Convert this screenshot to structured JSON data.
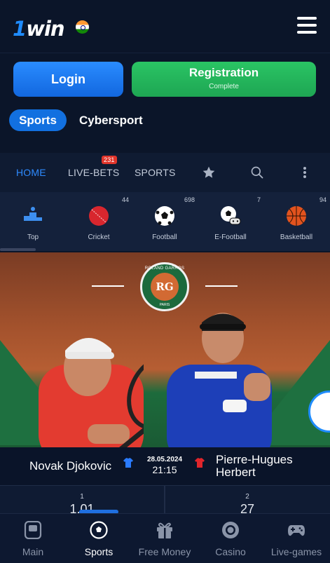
{
  "header": {
    "logo_one": "1",
    "logo_win": "win",
    "menu_icon": "hamburger-menu-icon"
  },
  "auth": {
    "login_label": "Login",
    "registration_label": "Registration",
    "registration_sub": "Complete"
  },
  "mode_toggle": {
    "sports": "Sports",
    "cybersport": "Cybersport"
  },
  "nav": {
    "home": "HOME",
    "live_bets": "LIVE-BETS",
    "live_bets_badge": "231",
    "sports": "SPORTS",
    "favorites_icon": "star-icon",
    "search_icon": "search-icon",
    "more_icon": "more-vertical-icon"
  },
  "categories": [
    {
      "label": "Top",
      "count": "",
      "icon": "podium-icon"
    },
    {
      "label": "Cricket",
      "count": "44",
      "icon": "cricket-ball-icon"
    },
    {
      "label": "Football",
      "count": "698",
      "icon": "football-icon"
    },
    {
      "label": "E-Football",
      "count": "7",
      "icon": "e-football-icon"
    },
    {
      "label": "Basketball",
      "count": "94",
      "icon": "basketball-icon"
    }
  ],
  "banner": {
    "logo_text": "ROLAND GARROS",
    "logo_sub": "PARIS",
    "logo_mono": "RG"
  },
  "match": {
    "team_left": "Novak Djokovic",
    "team_right": "Pierre-Hugues Herbert",
    "date": "28.05.2024",
    "time": "21:15",
    "team_left_color": "#2a7bff",
    "team_right_color": "#e0252b"
  },
  "odds": [
    {
      "label": "1",
      "value": "1.01"
    },
    {
      "label": "2",
      "value": "27"
    }
  ],
  "bottom_nav": [
    {
      "label": "Main",
      "icon": "main-icon"
    },
    {
      "label": "Sports",
      "icon": "sports-ball-icon"
    },
    {
      "label": "Free Money",
      "icon": "gift-icon"
    },
    {
      "label": "Casino",
      "icon": "casino-chip-icon"
    },
    {
      "label": "Live-games",
      "icon": "gamepad-icon"
    }
  ],
  "colors": {
    "background": "#0b1529",
    "accent_blue": "#1f8cff",
    "registration_green": "#22b35b",
    "badge_red": "#e0352b"
  }
}
